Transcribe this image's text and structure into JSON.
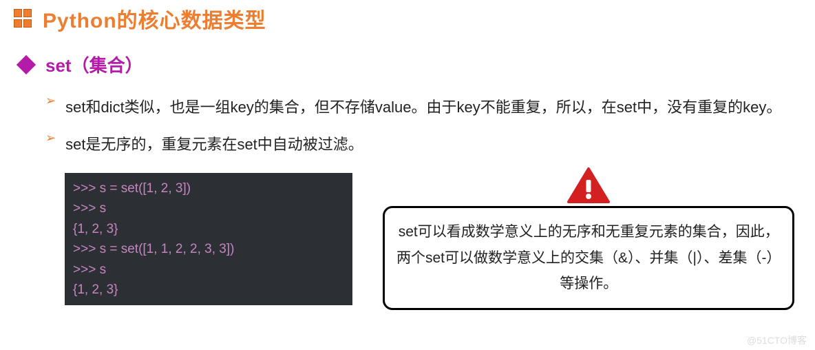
{
  "title": "Python的核心数据类型",
  "subtitle": "set（集合）",
  "bullets": [
    "set和dict类似，也是一组key的集合，但不存储value。由于key不能重复，所以，在set中，没有重复的key。",
    "set是无序的，重复元素在set中自动被过滤。"
  ],
  "code": {
    "line1": ">>> s = set([1, 2, 3])",
    "line2": ">>> s",
    "line3": "{1, 2, 3}",
    "line4": ">>> s = set([1, 1, 2, 2, 3, 3])",
    "line5": ">>> s",
    "line6": "{1, 2, 3}"
  },
  "callout": "set可以看成数学意义上的无序和无重复元素的集合，因此，两个set可以做数学意义上的交集（&）、并集（|）、差集（-）等操作。",
  "watermark": "@51CTO博客"
}
